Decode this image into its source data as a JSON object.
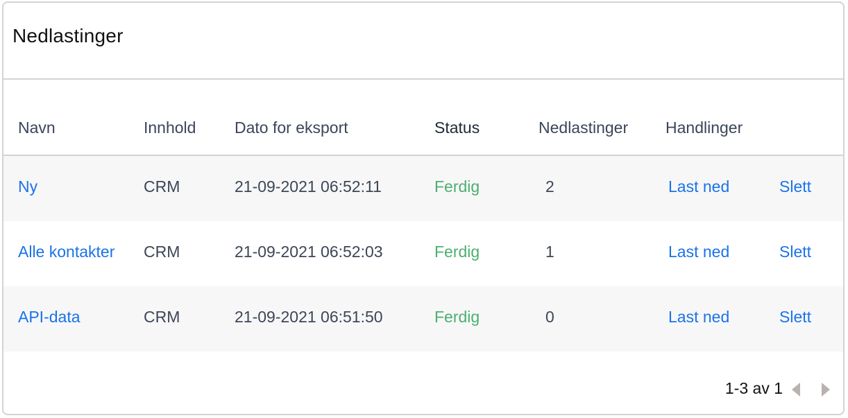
{
  "title": "Nedlastinger",
  "columns": {
    "name": "Navn",
    "content": "Innhold",
    "date": "Dato for eksport",
    "status": "Status",
    "downloads": "Nedlastinger",
    "actions": "Handlinger"
  },
  "rows": [
    {
      "name": "Ny",
      "content": "CRM",
      "date": "21-09-2021 06:52:11",
      "status": "Ferdig",
      "downloads": "2",
      "download_label": "Last ned",
      "delete_label": "Slett"
    },
    {
      "name": "Alle kontakter",
      "content": "CRM",
      "date": "21-09-2021 06:52:03",
      "status": "Ferdig",
      "downloads": "1",
      "download_label": "Last ned",
      "delete_label": "Slett"
    },
    {
      "name": "API-data",
      "content": "CRM",
      "date": "21-09-2021 06:51:50",
      "status": "Ferdig",
      "downloads": "0",
      "download_label": "Last ned",
      "delete_label": "Slett"
    }
  ],
  "pagination": {
    "label": "1-3 av 1",
    "prev_icon": "chevron-left-icon",
    "next_icon": "chevron-right-icon"
  },
  "colors": {
    "link": "#1a73e8",
    "status_done": "#4caf6e",
    "row_stripe": "#f7f7f8",
    "border": "#d2d3d7"
  }
}
